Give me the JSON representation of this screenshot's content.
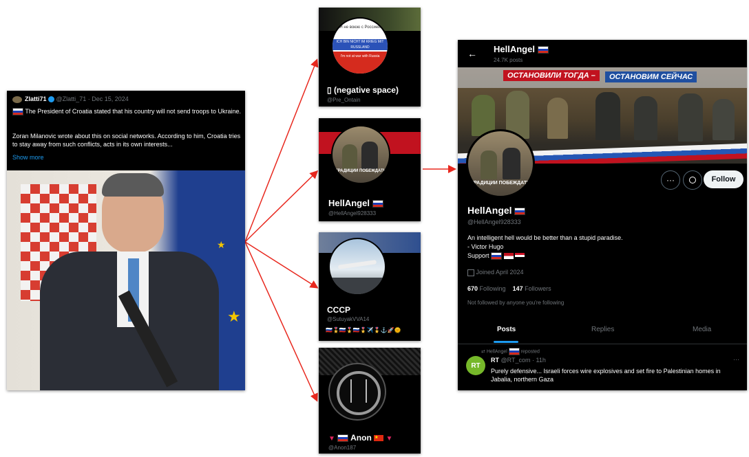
{
  "tweet": {
    "user": "Zlatti71",
    "handle_date": "@Zlatti_71 · Dec 15, 2024",
    "line1": "The President of Croatia stated that his country will not send troops to Ukraine.",
    "line2": "Zoran Milanovic wrote about this on social networks. According to him, Croatia tries to stay away from such conflicts, acts in its own interests...",
    "show_more": "Show more"
  },
  "accounts": [
    {
      "avatar_text_1": "Я не воюю с Россией",
      "avatar_text_2": "ICH BIN NICHT IM KRIEG MIT RUSSLAND",
      "avatar_text_3": "I'm not at war with Russia",
      "name": "▯ (negative space)",
      "handle": "@Pre_Ontain"
    },
    {
      "avatar_caption": "ТРАДИЦИИ ПОБЕЖДАТЬ",
      "name": "HellAngel",
      "handle": "@HellAngel928333"
    },
    {
      "name": "CCCP",
      "handle": "@SutuyakVVA14",
      "emoji_row": "🇷🇺🎖️🇷🇺🎖️🇷🇺🎖️✈️🎖️⚓🚀🌞"
    },
    {
      "name": "Anon",
      "handle": "@Anon187"
    }
  ],
  "profile": {
    "back_arrow": "←",
    "header_name": "HellAngel",
    "posts_count": "24.7K posts",
    "banner_left": "ОСТАНОВИЛИ ТОГДА –",
    "banner_right": "ОСТАНОВИМ СЕЙЧАС",
    "avatar_caption": "ТРАДИЦИИ ПОБЕЖДАТЬ",
    "more_icon": "···",
    "follow_label": "Follow",
    "name": "HellAngel",
    "handle": "@HellAngel928333",
    "bio_1": "An intelligent hell would be better than a stupid paradise.",
    "bio_2": "- Victor Hugo",
    "bio_3": "Support",
    "joined": "Joined April 2024",
    "following_count": "670",
    "following_label": "Following",
    "followers_count": "147",
    "followers_label": "Followers",
    "not_followed": "Not followed by anyone you're following",
    "tabs": [
      "Posts",
      "Replies",
      "Media"
    ],
    "repost_by": "HellAngel",
    "repost_label": "reposted",
    "post_author": "RT",
    "post_meta": "@RT_com · 11h",
    "post_avatar": "RT",
    "post_text": "Purely defensive... Israeli forces wire explosives and set fire to Palestinian homes in Jabalia, northern Gaza",
    "post_more": "···"
  },
  "colors": {
    "arrow": "#e8281e",
    "background": "#ffffff",
    "card": "#000000",
    "link": "#1d9bf0"
  }
}
